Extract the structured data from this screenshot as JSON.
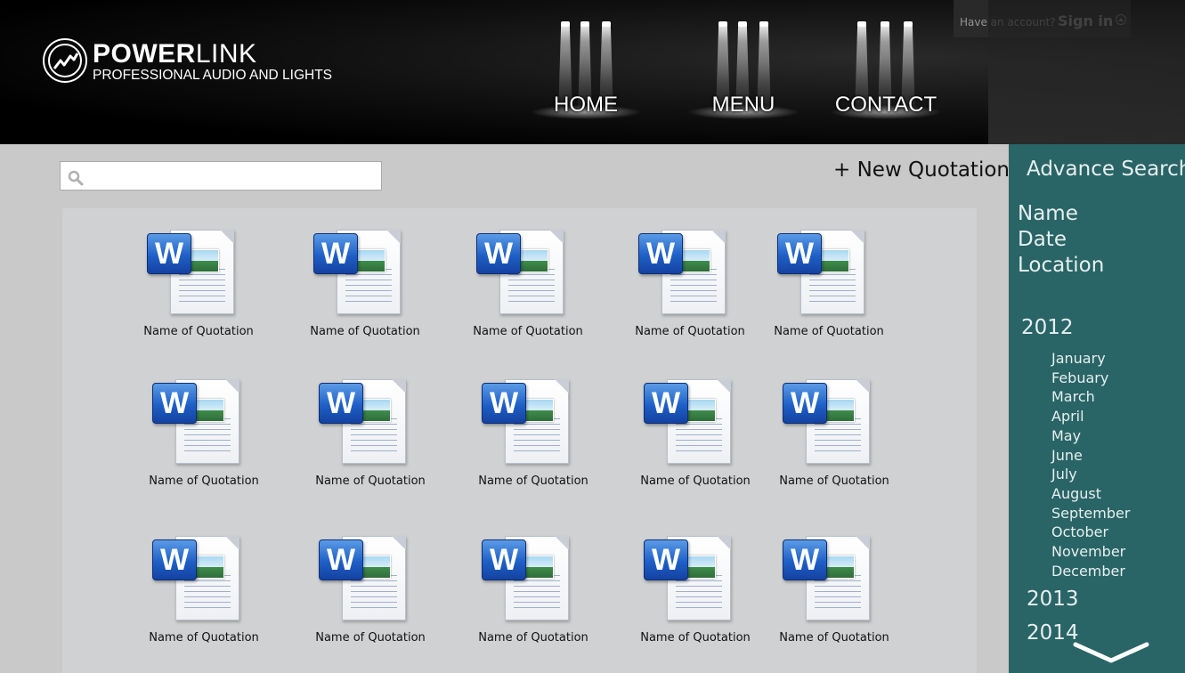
{
  "header": {
    "logo": {
      "name_bold": "POWER",
      "name_light": "LINK",
      "tagline": "PROFESSIONAL AUDIO AND LIGHTS"
    },
    "nav": [
      "HOME",
      "MENU",
      "CONTACT"
    ],
    "account": {
      "question": "Have an account?",
      "signin": "Sign in"
    }
  },
  "toolbar": {
    "search_placeholder": "",
    "new_quotation": "+ New Quotation"
  },
  "documents": [
    "Name of Quotation",
    "Name of Quotation",
    "Name of Quotation",
    "Name of Quotation",
    "Name of Quotation",
    "Name of Quotation",
    "Name of Quotation",
    "Name of Quotation",
    "Name of Quotation",
    "Name of Quotation",
    "Name of Quotation",
    "Name of Quotation",
    "Name of Quotation",
    "Name of Quotation",
    "Name of Quotation"
  ],
  "document_icon_letter": "W",
  "sidebar": {
    "title": "Advance Search",
    "filters": [
      "Name",
      "Date",
      "Location"
    ],
    "years": [
      "2012",
      "2013",
      "2014"
    ],
    "months": [
      "January",
      "Febuary",
      "March",
      "April",
      "May",
      "June",
      "July",
      "August",
      "September",
      "October",
      "November",
      "December"
    ]
  },
  "colors": {
    "sidebar_bg": "#296466",
    "content_bg": "#c9c9c9",
    "header_bg": "#000000"
  }
}
